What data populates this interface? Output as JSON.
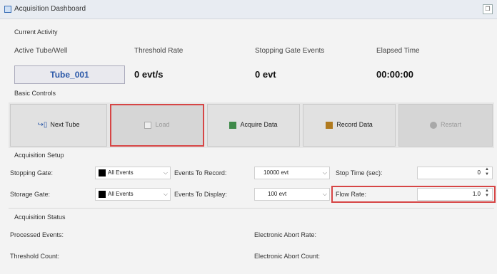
{
  "window": {
    "title": "Acquisition Dashboard",
    "restore_glyph": "❐"
  },
  "current_activity": {
    "section": "Current Activity",
    "headers": [
      "Active Tube/Well",
      "Threshold Rate",
      "Stopping Gate Events",
      "Elapsed Time"
    ],
    "tube": "Tube_001",
    "rate": "0 evt/s",
    "events": "0 evt",
    "elapsed": "00:00:00"
  },
  "basic_controls": {
    "section": "Basic Controls",
    "buttons": {
      "next_tube": "Next Tube",
      "load": "Load",
      "acquire": "Acquire Data",
      "record": "Record Data",
      "restart": "Restart"
    },
    "colors": {
      "acquire": "#3f8a4a",
      "record": "#b07a1f",
      "highlight": "#d64545"
    }
  },
  "acquisition_setup": {
    "section": "Acquisition Setup",
    "stopping_gate_label": "Stopping Gate:",
    "stopping_gate_value": "All Events",
    "storage_gate_label": "Storage Gate:",
    "storage_gate_value": "All Events",
    "events_to_record_label": "Events To Record:",
    "events_to_record_value": "10000 evt",
    "events_to_display_label": "Events To Display:",
    "events_to_display_value": "100 evt",
    "stop_time_label": "Stop Time (sec):",
    "stop_time_value": "0",
    "flow_rate_label": "Flow Rate:",
    "flow_rate_value": "1.0"
  },
  "acquisition_status": {
    "section": "Acquisition Status",
    "processed_events_label": "Processed Events:",
    "threshold_count_label": "Threshold Count:",
    "electronic_abort_rate_label": "Electronic Abort Rate:",
    "electronic_abort_count_label": "Electronic Abort Count:"
  }
}
